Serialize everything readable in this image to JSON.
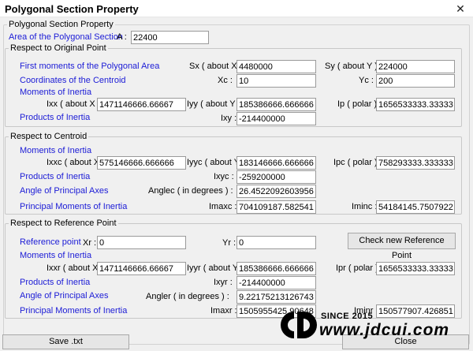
{
  "window": {
    "title": "Polygonal Section Property",
    "close_glyph": "✕"
  },
  "outer_group": {
    "legend": "Polygonal Section Property"
  },
  "area": {
    "label": "Area of the Polygonal Section",
    "symbol": "A :",
    "value": "22400"
  },
  "original_point": {
    "legend": "Respect to Original Point",
    "first_moments_label": "First moments of the Polygonal Area",
    "sx_label": "Sx ( about X ) :",
    "sx_value": "4480000",
    "sy_label": "Sy ( about Y ) :",
    "sy_value": "224000",
    "centroid_label": "Coordinates of the Centroid",
    "xc_label": "Xc :",
    "xc_value": "10",
    "yc_label": "Yc :",
    "yc_value": "200",
    "moments_label": "Moments of Inertia",
    "ixx_label": "Ixx ( about X ) :",
    "ixx_value": "1471146666.66667",
    "iyy_label": "Iyy ( about Y ) :",
    "iyy_value": "185386666.666666",
    "ip_label": "Ip ( polar ) :",
    "ip_value": "1656533333.33333",
    "products_label": "Products of Inertia",
    "ixy_label": "Ixy :",
    "ixy_value": "-214400000"
  },
  "centroid": {
    "legend": "Respect to Centroid",
    "moments_label": "Moments of Inertia",
    "ixxc_label": "Ixxc ( about X ) :",
    "ixxc_value": "575146666.666666",
    "iyyc_label": "Iyyc ( about Y ) :",
    "iyyc_value": "183146666.666666",
    "ipc_label": "Ipc ( polar ) :",
    "ipc_value": "758293333.333333",
    "products_label": "Products of Inertia",
    "ixyc_label": "Ixyc :",
    "ixyc_value": "-259200000",
    "angle_label": "Angle of Principal Axes",
    "anglec_label": "Anglec ( in degrees ) :",
    "anglec_value": "26.4522092603956",
    "principal_label": "Principal Moments of Inertia",
    "imaxc_label": "Imaxc :",
    "imaxc_value": "704109187.582541",
    "iminc_label": "Iminc :",
    "iminc_value": "54184145.7507922"
  },
  "reference": {
    "legend": "Respect to Reference Point",
    "ref_label": "Reference point",
    "xr_label": "Xr :",
    "xr_value": "0",
    "yr_label": "Yr :",
    "yr_value": "0",
    "check_button": "Check new Reference Point",
    "moments_label": "Moments of Inertia",
    "ixxr_label": "Ixxr ( about X ) :",
    "ixxr_value": "1471146666.66667",
    "iyyr_label": "Iyyr ( about Y ) :",
    "iyyr_value": "185386666.666666",
    "ipr_label": "Ipr ( polar ) :",
    "ipr_value": "1656533333.33333",
    "products_label": "Products of Inertia",
    "ixyr_label": "Ixyr :",
    "ixyr_value": "-214400000",
    "angle_label": "Angle of Principal Axes",
    "angler_label": "Angler ( in degrees ) :",
    "angler_value": "9.22175213126743",
    "principal_label": "Principal Moments of Inertia",
    "imaxr_label": "Imaxr :",
    "imaxr_value": "1505955425.90648",
    "iminr_label": "Iminr :",
    "iminr_value": "150577907.426851"
  },
  "buttons": {
    "save": "Save .txt",
    "close": "Close"
  },
  "watermark": {
    "since": "SINCE 2015",
    "url": "www.jdcui.com",
    "logo_icon": "cd-logo-icon"
  }
}
